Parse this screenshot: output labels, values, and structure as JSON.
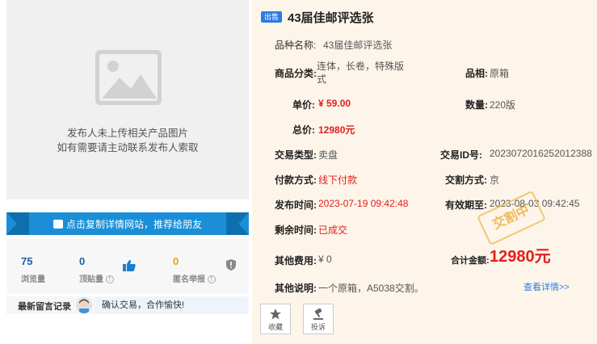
{
  "image_placeholder": {
    "line1": "发布人未上传相关产品图片",
    "line2": "如有需要请主动联系发布人索取"
  },
  "share_bar": {
    "label": "点击复制详情网站，推荐给朋友"
  },
  "stats": {
    "views": {
      "value": "75",
      "label": "浏览量"
    },
    "likes": {
      "value": "0",
      "label": "顶贴量"
    },
    "reports": {
      "value": "0",
      "label": "匿名举报"
    }
  },
  "comments": {
    "title": "最新留言记录",
    "latest": "确认交易，合作愉快!"
  },
  "listing": {
    "badge": "出售",
    "title": "43届佳邮评选张",
    "fields": {
      "variety_label": "品种名称:",
      "variety_value": "43届佳邮评选张",
      "category_label": "商品分类:",
      "category_value_line1": "连体，长卷，特殊版",
      "category_value_line2": "式",
      "condition_label": "品相:",
      "condition_value": "原箱",
      "unit_price_label": "单价:",
      "unit_price_value": "¥ 59.00",
      "quantity_label": "数量:",
      "quantity_value": "220版",
      "total_label": "总价:",
      "total_value": "12980元",
      "trade_type_label": "交易类型:",
      "trade_type_value": "卖盘",
      "trade_id_label": "交易ID号:",
      "trade_id_value": "2023072016252012388",
      "payment_label": "付款方式:",
      "payment_value": "线下付款",
      "delivery_label": "交割方式:",
      "delivery_value": "京",
      "publish_time_label": "发布时间:",
      "publish_time_value": "2023-07-19 09:42:48",
      "valid_until_label": "有效期至:",
      "valid_until_value": "2023-08-03 09:42:45",
      "remaining_label": "剩余时间:",
      "remaining_value": "已成交",
      "other_fee_label": "其他费用:",
      "other_fee_value": "¥ 0",
      "grand_total_label": "合计金额:",
      "grand_total_value": "12980元",
      "note_label": "其他说明:",
      "note_value": "一个原箱，A5038交割。"
    },
    "stamp": "交割中",
    "more_link": "查看详情>>",
    "actions": {
      "favorite": "收藏",
      "complain": "投诉"
    }
  },
  "colors": {
    "accent": "#2c7be5",
    "price": "#e0201c",
    "panel_bg": "#fdf5ea",
    "share_bar": "#1a8fd8"
  }
}
